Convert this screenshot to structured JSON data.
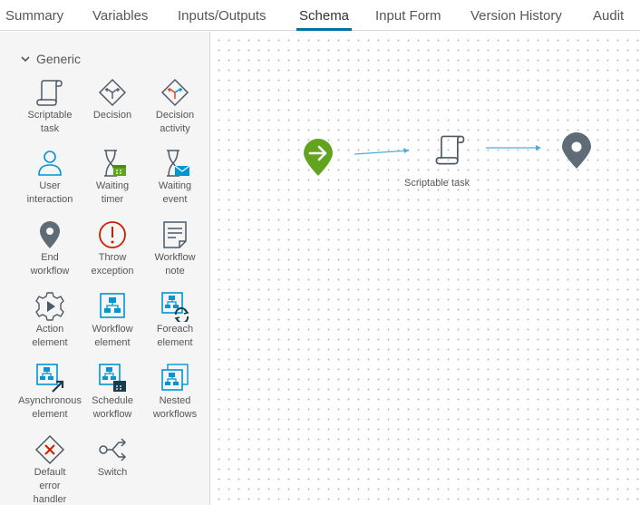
{
  "tabs": [
    {
      "label": "Summary",
      "active": false
    },
    {
      "label": "Variables",
      "active": false
    },
    {
      "label": "Inputs/Outputs",
      "active": false
    },
    {
      "label": "Schema",
      "active": true
    },
    {
      "label": "Input Form",
      "active": false
    },
    {
      "label": "Version History",
      "active": false
    },
    {
      "label": "Audit",
      "active": false
    }
  ],
  "palette": {
    "group_label": "Generic",
    "items": [
      {
        "label": "Scriptable\ntask",
        "icon": "scroll-icon"
      },
      {
        "label": "Decision",
        "icon": "decision-icon"
      },
      {
        "label": "Decision\nactivity",
        "icon": "decision-activity-icon"
      },
      {
        "label": "User\ninteraction",
        "icon": "user-icon"
      },
      {
        "label": "Waiting\ntimer",
        "icon": "hourglass-calendar-icon"
      },
      {
        "label": "Waiting\nevent",
        "icon": "hourglass-envelope-icon"
      },
      {
        "label": "End\nworkflow",
        "icon": "map-pin-icon"
      },
      {
        "label": "Throw\nexception",
        "icon": "exclamation-circle-icon"
      },
      {
        "label": "Workflow\nnote",
        "icon": "note-icon"
      },
      {
        "label": "Action\nelement",
        "icon": "gear-play-icon"
      },
      {
        "label": "Workflow\nelement",
        "icon": "workflow-icon"
      },
      {
        "label": "Foreach\nelement",
        "icon": "workflow-loop-icon"
      },
      {
        "label": "Asynchronous\nelement",
        "icon": "workflow-arrow-icon"
      },
      {
        "label": "Schedule\nworkflow",
        "icon": "workflow-calendar-icon"
      },
      {
        "label": "Nested\nworkflows",
        "icon": "nested-workflows-icon"
      },
      {
        "label": "Default\nerror\nhandler",
        "icon": "error-diamond-icon"
      },
      {
        "label": "Switch",
        "icon": "switch-icon"
      }
    ]
  },
  "canvas": {
    "nodes": [
      {
        "type": "start",
        "icon": "start-arrow-icon",
        "color": "#62a420"
      },
      {
        "type": "scriptable-task",
        "label": "Scriptable task",
        "icon": "scroll-icon"
      },
      {
        "type": "end",
        "icon": "map-pin-icon",
        "color": "#5f6b76"
      }
    ],
    "connector_color": "#49afd9"
  },
  "colors": {
    "accent": "#0072a3",
    "icon_blue": "#0095d3",
    "icon_dark": "#4d5a66",
    "green": "#62a420",
    "red": "#c92100"
  }
}
